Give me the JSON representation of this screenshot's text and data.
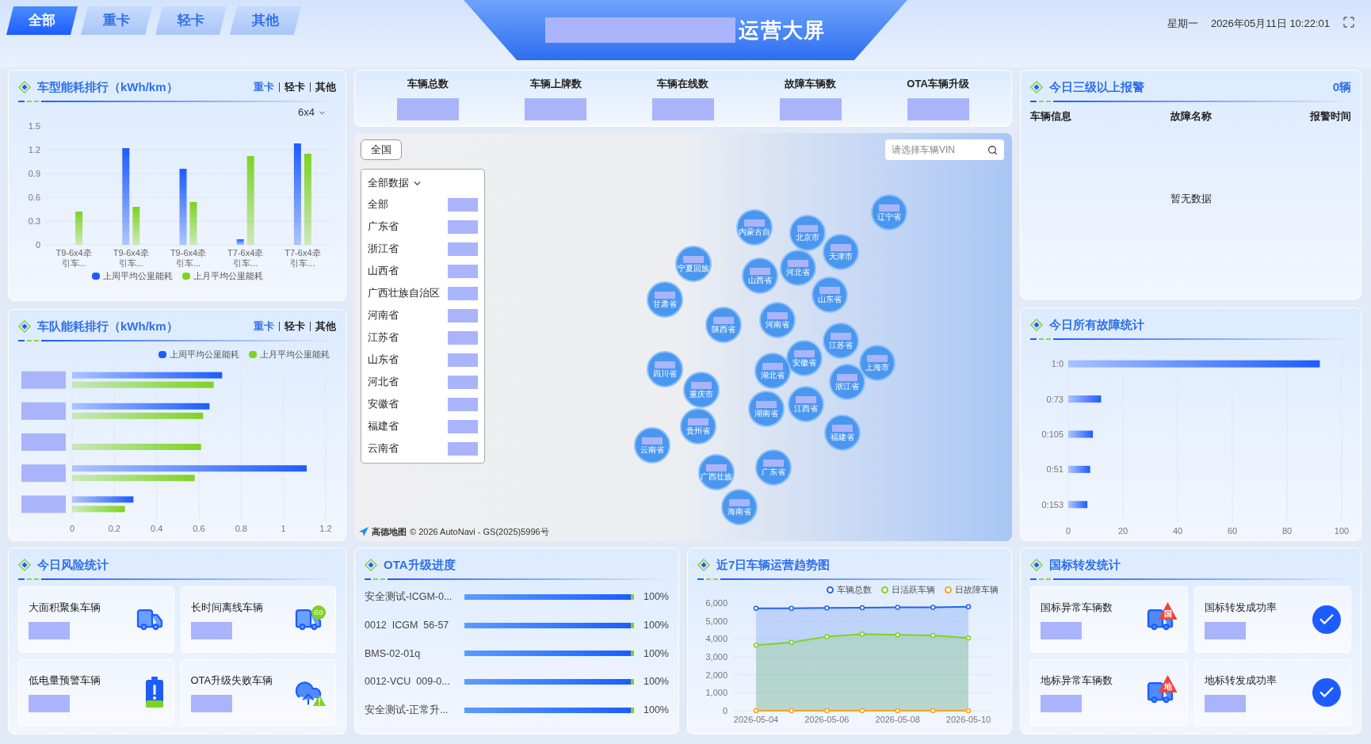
{
  "header": {
    "tabs": [
      {
        "label": "全部",
        "selected": true
      },
      {
        "label": "重卡",
        "selected": false
      },
      {
        "label": "轻卡",
        "selected": false
      },
      {
        "label": "其他",
        "selected": false
      }
    ],
    "title": "运营大屏",
    "weekday": "星期一",
    "datetime": "2026年05月11日 10:22:01"
  },
  "model_energy": {
    "title": "车型能耗排行（kWh/km）",
    "tabs": [
      {
        "label": "重卡",
        "selected": true
      },
      {
        "label": "轻卡",
        "selected": false
      },
      {
        "label": "其他",
        "selected": false
      }
    ],
    "filter": "6x4",
    "chart_data": {
      "type": "bar",
      "grid": true,
      "categories": [
        "T9-6x4牵引车...",
        "T9-6x4牵引车...",
        "T9-6x4牵引车...",
        "T7-6x4牵引车...",
        "T7-6x4牵引车..."
      ],
      "ylim": [
        0,
        1.5
      ],
      "yticks": [
        0,
        0.3,
        0.6,
        0.9,
        1.2,
        1.5
      ],
      "series": [
        {
          "name": "上周平均公里能耗",
          "color": "#1d5cff",
          "values": [
            0,
            1.22,
            0.96,
            0.07,
            1.28
          ]
        },
        {
          "name": "上月平均公里能耗",
          "color": "#7ed321",
          "values": [
            0.42,
            0.48,
            0.54,
            1.12,
            1.15
          ]
        }
      ]
    }
  },
  "fleet_energy": {
    "title": "车队能耗排行（kWh/km）",
    "tabs": [
      {
        "label": "重卡",
        "selected": true
      },
      {
        "label": "轻卡",
        "selected": false
      },
      {
        "label": "其他",
        "selected": false
      }
    ],
    "chart_data": {
      "type": "bar",
      "grid": true,
      "orientation": "horizontal",
      "xlim": [
        0,
        1.2
      ],
      "xticks": [
        0,
        0.2,
        0.4,
        0.6,
        0.8,
        1,
        1.2
      ],
      "series": [
        {
          "name": "上周平均公里能耗",
          "color": "#1d5cff",
          "values": [
            0.71,
            0.65,
            null,
            1.11,
            0.29
          ]
        },
        {
          "name": "上月平均公里能耗",
          "color": "#7ed321",
          "values": [
            0.67,
            0.62,
            0.61,
            0.58,
            0.25
          ]
        }
      ]
    }
  },
  "stats": [
    "车辆总数",
    "车辆上牌数",
    "车辆在线数",
    "故障车辆数",
    "OTA车辆升级"
  ],
  "map": {
    "scope_button": "全国",
    "region_dropdown": {
      "label": "全部数据",
      "items": [
        "全部",
        "广东省",
        "浙江省",
        "山西省",
        "广西壮族自治区",
        "河南省",
        "江苏省",
        "山东省",
        "河北省",
        "安徽省",
        "福建省",
        "云南省"
      ]
    },
    "search": {
      "placeholder": "请选择车辆VIN"
    },
    "markers": [
      "内蒙古自",
      "宁夏回族",
      "甘肃省",
      "北京市",
      "天津市",
      "山西省",
      "河北省",
      "山东省",
      "辽宁省",
      "陕西省",
      "河南省",
      "安徽省",
      "江苏省",
      "上海市",
      "浙江省",
      "四川省",
      "重庆市",
      "湖北省",
      "湖南省",
      "江西省",
      "贵州省",
      "福建省",
      "云南省",
      "广西壮族",
      "广东省",
      "海南省"
    ],
    "attribution": {
      "logo": "高德地图",
      "text": "© 2026 AutoNavi - GS(2025)5996号"
    }
  },
  "alerts": {
    "title": "今日三级以上报警",
    "count": "0辆",
    "columns": [
      "车辆信息",
      "故障名称",
      "报警时间"
    ],
    "empty": "暂无数据"
  },
  "faults": {
    "title": "今日所有故障统计",
    "chart_data": {
      "type": "bar",
      "grid": true,
      "orientation": "horizontal",
      "categories": [
        "1:0",
        "0:73",
        "0:105",
        "0:51",
        "0:153"
      ],
      "values": [
        92,
        12,
        9,
        8,
        7
      ],
      "xlim": [
        0,
        100
      ],
      "xticks": [
        0,
        20,
        40,
        60,
        80,
        100
      ]
    }
  },
  "risk": {
    "title": "今日风险统计",
    "cards": [
      {
        "label": "大面积聚集车辆",
        "kind": "cluster"
      },
      {
        "label": "长时间离线车辆",
        "kind": "offline"
      },
      {
        "label": "低电量预警车辆",
        "kind": "battery"
      },
      {
        "label": "OTA升级失败车辆",
        "kind": "ota"
      }
    ]
  },
  "ota": {
    "title": "OTA升级进度",
    "rows": [
      {
        "name": "安全测试-ICGM-0...",
        "level": 1,
        "reading": "100%"
      },
      {
        "name": "0012  ICGM  56-57",
        "level": 1,
        "reading": "100%"
      },
      {
        "name": "BMS-02-01q",
        "level": 1,
        "reading": "100%"
      },
      {
        "name": "0012-VCU  009-0...",
        "level": 1,
        "reading": "100%"
      },
      {
        "name": "安全测试-正常升...",
        "level": 1,
        "reading": "100%"
      }
    ]
  },
  "trend": {
    "title": "近7日车辆运营趋势图",
    "chart_data": {
      "type": "line",
      "grid": true,
      "categories": [
        "2026-05-04",
        null,
        "2026-05-06",
        null,
        "2026-05-08",
        null,
        "2026-05-10"
      ],
      "ylim": [
        0,
        6000
      ],
      "yticks": [
        {
          "value": 0,
          "label": "0"
        },
        {
          "value": 1000,
          "label": "1,000"
        },
        {
          "value": 2000,
          "label": "2,000"
        },
        {
          "value": 3000,
          "label": "3,000"
        },
        {
          "value": 4000,
          "label": "4,000"
        },
        {
          "value": 5000,
          "label": "5,000"
        },
        {
          "value": 6000,
          "label": "6,000"
        }
      ],
      "series": [
        {
          "name": "车辆总数",
          "type": "area",
          "color": "#2563eb",
          "marker": true,
          "values": [
            5700,
            5700,
            5720,
            5740,
            5760,
            5760,
            5790
          ]
        },
        {
          "name": "日活跃车辆",
          "type": "area",
          "color": "#7ed321",
          "marker": true,
          "values": [
            3650,
            3800,
            4130,
            4270,
            4220,
            4190,
            4050
          ]
        },
        {
          "name": "日故障车辆",
          "type": "line",
          "color": "#f5a623",
          "marker": true,
          "values": [
            0,
            0,
            0,
            0,
            0,
            0,
            0
          ]
        }
      ]
    }
  },
  "national": {
    "title": "国标转发统计",
    "cards": [
      {
        "label": "国标异常车辆数",
        "kind": "alert-truck",
        "badge": "国"
      },
      {
        "label": "国标转发成功率",
        "kind": "check"
      },
      {
        "label": "地标异常车辆数",
        "kind": "alert-truck",
        "badge": "地"
      },
      {
        "label": "地标转发成功率",
        "kind": "check"
      }
    ]
  }
}
